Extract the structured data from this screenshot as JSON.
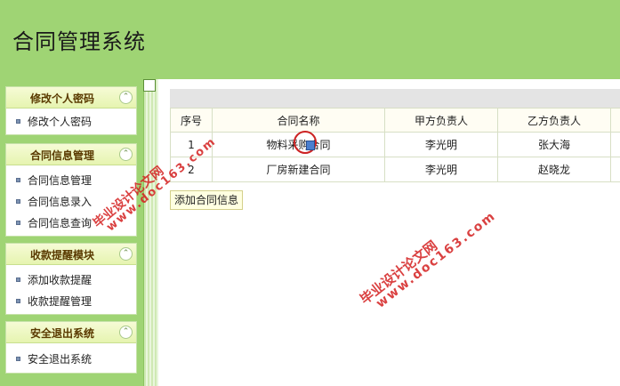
{
  "app": {
    "title": "合同管理系统"
  },
  "sidebar": {
    "panels": [
      {
        "title": "修改个人密码",
        "items": [
          "修改个人密码"
        ]
      },
      {
        "title": "合同信息管理",
        "items": [
          "合同信息管理",
          "合同信息录入",
          "合同信息查询"
        ]
      },
      {
        "title": "收款提醒模块",
        "items": [
          "添加收款提醒",
          "收款提醒管理"
        ]
      },
      {
        "title": "安全退出系统",
        "items": [
          "安全退出系统"
        ]
      }
    ],
    "collapse_glyph": "⌃"
  },
  "table": {
    "headers": [
      "序号",
      "合同名称",
      "甲方负责人",
      "乙方负责人"
    ],
    "rows": [
      [
        "1",
        "物料采购合同",
        "李光明",
        "张大海"
      ],
      [
        "2",
        "厂房新建合同",
        "李光明",
        "赵晓龙"
      ]
    ]
  },
  "actions": {
    "add_label": "添加合同信息"
  },
  "watermark": {
    "cn": "毕业设计论文网",
    "url": "www.doc163.com"
  },
  "colors": {
    "brand_green": "#9fd474",
    "panel_title": "#5a3a00",
    "watermark_red": "#d42020"
  }
}
